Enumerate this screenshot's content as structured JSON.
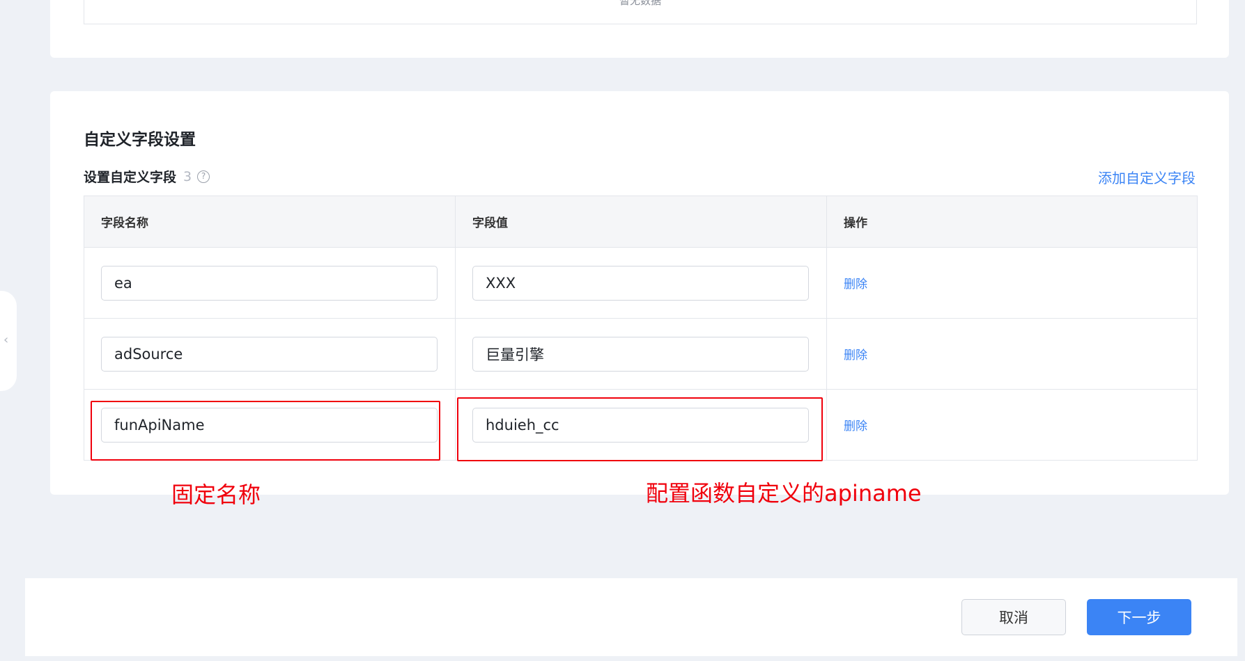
{
  "top_card": {
    "empty_text": "暂无数据"
  },
  "section": {
    "title": "自定义字段设置",
    "subtitle": "设置自定义字段",
    "count": "3",
    "help": "?",
    "add_link": "添加自定义字段"
  },
  "table": {
    "headers": [
      "字段名称",
      "字段值",
      "操作"
    ],
    "rows": [
      {
        "name": "ea",
        "value": "XXX",
        "action": "删除"
      },
      {
        "name": "adSource",
        "value": "巨量引擎",
        "action": "删除"
      },
      {
        "name": "funApiName",
        "value": "hduieh_cc",
        "action": "删除"
      }
    ]
  },
  "annotations": {
    "left": "固定名称",
    "right": "配置函数自定义的apiname",
    "color": "#f0000c"
  },
  "side_handle": {
    "icon": "chevron-left-icon",
    "glyph": "‹"
  },
  "footer": {
    "cancel": "取消",
    "next": "下一步"
  },
  "colors": {
    "accent": "#3b84f5",
    "background": "#eef1f6"
  }
}
